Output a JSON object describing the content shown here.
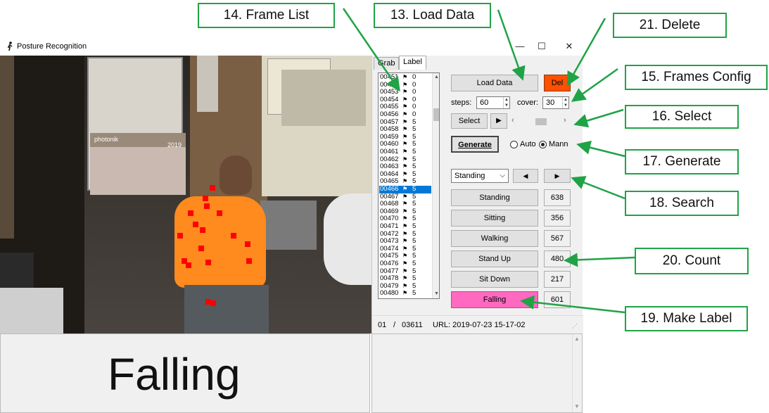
{
  "window": {
    "title": "Posture Recognition",
    "min_glyph": "—",
    "max_glyph": "☐",
    "close_glyph": "✕"
  },
  "tabs": [
    {
      "label": "Grab",
      "active": false
    },
    {
      "label": "Label",
      "active": true
    }
  ],
  "frame_list": {
    "rows": [
      {
        "id": "00451",
        "count": "0"
      },
      {
        "id": "00452",
        "count": "0"
      },
      {
        "id": "00453",
        "count": "0"
      },
      {
        "id": "00454",
        "count": "0"
      },
      {
        "id": "00455",
        "count": "0"
      },
      {
        "id": "00456",
        "count": "0"
      },
      {
        "id": "00457",
        "count": "5"
      },
      {
        "id": "00458",
        "count": "5"
      },
      {
        "id": "00459",
        "count": "5"
      },
      {
        "id": "00460",
        "count": "5"
      },
      {
        "id": "00461",
        "count": "5"
      },
      {
        "id": "00462",
        "count": "5"
      },
      {
        "id": "00463",
        "count": "5"
      },
      {
        "id": "00464",
        "count": "5"
      },
      {
        "id": "00465",
        "count": "5"
      },
      {
        "id": "00466",
        "count": "5"
      },
      {
        "id": "00467",
        "count": "5"
      },
      {
        "id": "00468",
        "count": "5"
      },
      {
        "id": "00469",
        "count": "5"
      },
      {
        "id": "00470",
        "count": "5"
      },
      {
        "id": "00471",
        "count": "5"
      },
      {
        "id": "00472",
        "count": "5"
      },
      {
        "id": "00473",
        "count": "5"
      },
      {
        "id": "00474",
        "count": "5"
      },
      {
        "id": "00475",
        "count": "5"
      },
      {
        "id": "00476",
        "count": "5"
      },
      {
        "id": "00477",
        "count": "5"
      },
      {
        "id": "00478",
        "count": "5"
      },
      {
        "id": "00479",
        "count": "5"
      },
      {
        "id": "00480",
        "count": "5"
      }
    ],
    "selected_id": "00466",
    "flag_glyph": "⚑"
  },
  "controls": {
    "load_data_label": "Load Data",
    "delete_label": "Del",
    "steps_label": "steps:",
    "steps_value": "60",
    "cover_label": "cover:",
    "cover_value": "30",
    "select_label": "Select",
    "play_glyph": "▶",
    "scroll_left_glyph": "‹",
    "scroll_right_glyph": "›",
    "generate_label": "Generate",
    "radio_auto_label": "Auto",
    "radio_mann_label": "Mann",
    "radio_selected": "Mann",
    "search_value": "Standing",
    "search_dropdown_glyph": "⌵",
    "prev_glyph": "◀",
    "next_glyph": "▶"
  },
  "labels": [
    {
      "name": "Standing",
      "count": "638"
    },
    {
      "name": "Sitting",
      "count": "356"
    },
    {
      "name": "Walking",
      "count": "567"
    },
    {
      "name": "Stand Up",
      "count": "480"
    },
    {
      "name": "Sit Down",
      "count": "217"
    },
    {
      "name": "Falling",
      "count": "601"
    }
  ],
  "active_label": "Falling",
  "status": {
    "frame": "01",
    "separator": "/",
    "total": "03611",
    "url": "URL: 2019-07-23 15-17-02"
  },
  "big_label": "Falling",
  "scene_text": {
    "brand": "photonik",
    "year": "2019"
  },
  "colors": {
    "delete_bg": "#ff5000",
    "falling_bg": "#ff69c0",
    "select_highlight": "#0078d7",
    "keypoint": "#ff0000",
    "callout_border": "#1fa346"
  },
  "annotations": [
    {
      "key": "frame_list",
      "text": "14. Frame List"
    },
    {
      "key": "load_data",
      "text": "13. Load Data"
    },
    {
      "key": "delete",
      "text": "21. Delete"
    },
    {
      "key": "frames_config",
      "text": "15. Frames Config"
    },
    {
      "key": "select",
      "text": "16. Select"
    },
    {
      "key": "generate",
      "text": "17. Generate"
    },
    {
      "key": "search",
      "text": "18. Search"
    },
    {
      "key": "count",
      "text": "20. Count"
    },
    {
      "key": "make_label",
      "text": "19. Make Label"
    }
  ]
}
